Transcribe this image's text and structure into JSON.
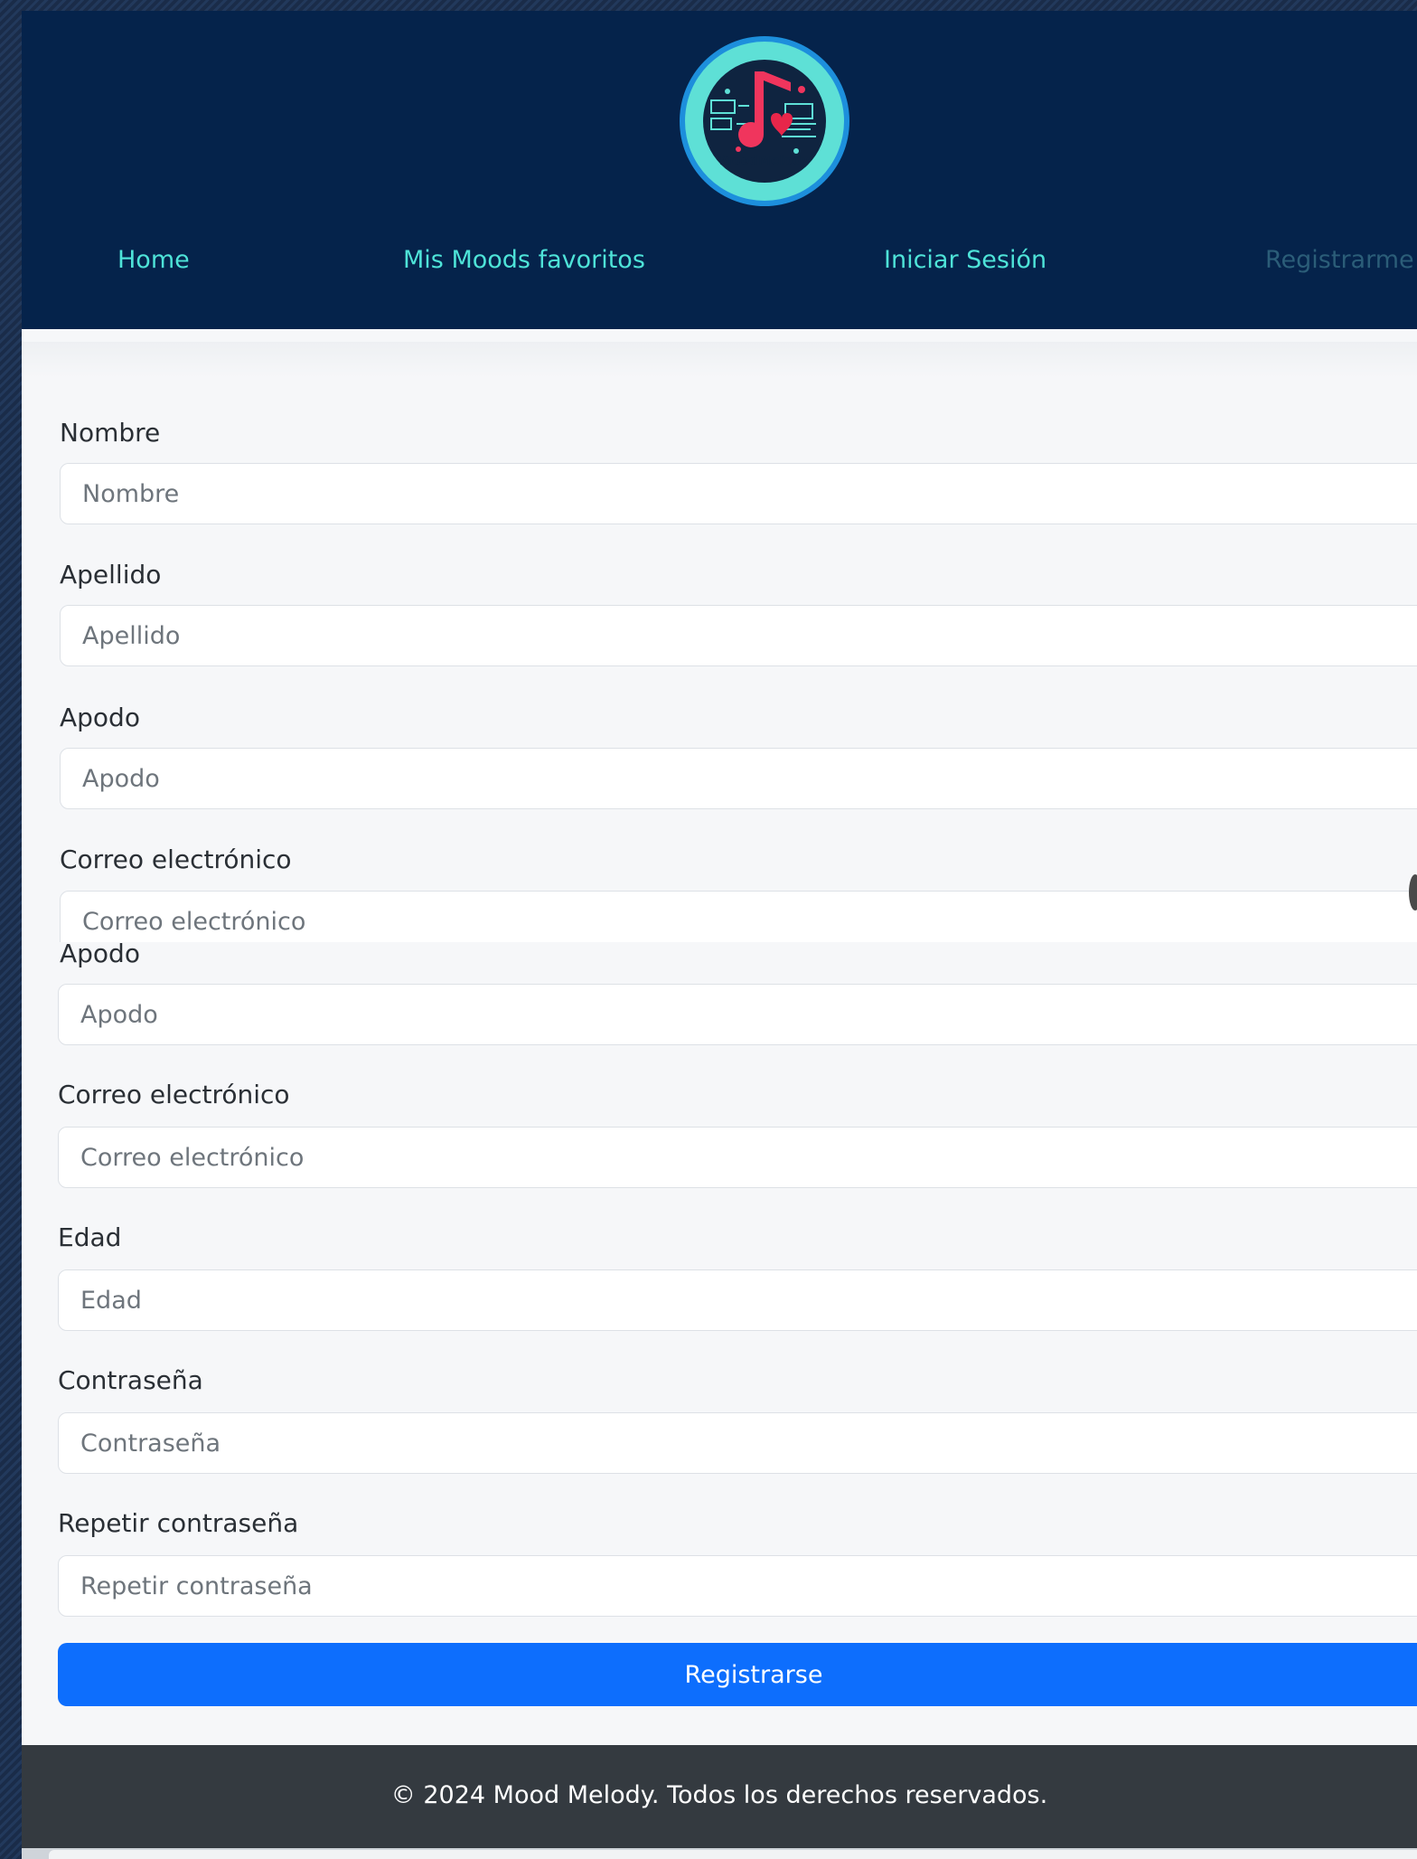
{
  "brand": {
    "name": "MoodMelody"
  },
  "nav": {
    "items": [
      {
        "label": "Home",
        "active": false
      },
      {
        "label": "Mis Moods favoritos",
        "active": false
      },
      {
        "label": "Iniciar Sesión",
        "active": false
      },
      {
        "label": "Registrarme",
        "active": true
      }
    ]
  },
  "form_top": {
    "fields": [
      {
        "label": "Nombre",
        "placeholder": "Nombre",
        "value": ""
      },
      {
        "label": "Apellido",
        "placeholder": "Apellido",
        "value": ""
      },
      {
        "label": "Apodo",
        "placeholder": "Apodo",
        "value": ""
      },
      {
        "label": "Correo electrónico",
        "placeholder": "Correo electrónico",
        "value": ""
      }
    ]
  },
  "form_bottom": {
    "fields": [
      {
        "label": "Apodo",
        "placeholder": "Apodo",
        "value": ""
      },
      {
        "label": "Correo electrónico",
        "placeholder": "Correo electrónico",
        "value": ""
      },
      {
        "label": "Edad",
        "placeholder": "Edad",
        "value": ""
      },
      {
        "label": "Contraseña",
        "placeholder": "Contraseña",
        "value": ""
      },
      {
        "label": "Repetir contraseña",
        "placeholder": "Repetir contraseña",
        "value": ""
      }
    ],
    "submit_label": "Registrarse"
  },
  "footer": {
    "text": "© 2024 Mood Melody. Todos los derechos reservados."
  },
  "colors": {
    "navbar_bg": "#05234b",
    "nav_link": "#4ee3d8",
    "nav_link_active": "#2b5d78",
    "primary_button": "#0d6efd",
    "footer_bg": "#343a40"
  }
}
